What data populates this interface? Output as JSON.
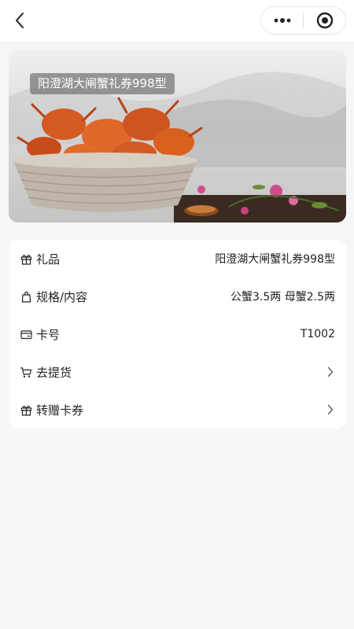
{
  "header": {
    "back_icon": "back-arrow-icon",
    "menu_icon": "more-dots-icon",
    "close_icon": "target-circle-icon"
  },
  "banner": {
    "title": "阳澄湖大闸蟹礼券998型"
  },
  "details": {
    "gift": {
      "icon": "gift-icon",
      "label": "礼品",
      "value": "阳澄湖大闸蟹礼券998型"
    },
    "spec": {
      "icon": "bag-icon",
      "label": "规格/内容",
      "value": "公蟹3.5两 母蟹2.5两"
    },
    "card_no": {
      "icon": "card-icon",
      "label": "卡号",
      "value": "T1002"
    },
    "pickup": {
      "icon": "cart-icon",
      "label": "去提货"
    },
    "transfer": {
      "icon": "gift-icon",
      "label": "转赠卡券"
    }
  },
  "colors": {
    "background": "#f5f6f8",
    "card": "#ffffff",
    "text": "#222222"
  }
}
